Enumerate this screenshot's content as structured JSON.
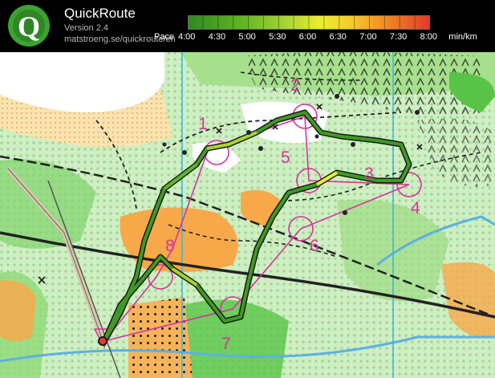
{
  "app": {
    "title": "QuickRoute",
    "version": "Version 2.4",
    "url": "matstroeng.se/quickroute/en",
    "logo_letter": "Q"
  },
  "pace_scale": {
    "label": "Pace",
    "ticks": [
      "4:00",
      "4:30",
      "5:00",
      "5:30",
      "6:00",
      "6:30",
      "7:00",
      "7:30",
      "8:00"
    ],
    "unit": "min/km",
    "colors": [
      "#2f8a1f",
      "#5fb523",
      "#a6d433",
      "#eaee2e",
      "#f7c92c",
      "#f08a26",
      "#e23b2a"
    ]
  },
  "map": {
    "controls": [
      "1",
      "2",
      "3",
      "4",
      "5",
      "6",
      "7",
      "8"
    ],
    "colors": {
      "course": "#d6339f",
      "route_outline": "#1a1a1a",
      "route_fast": "#2f8a1f",
      "route_slow": "#a6d433",
      "vegetation": "#6dcf58",
      "open_land": "#f7a94a",
      "water": "#5db0e3",
      "meridian": "#36b6e0"
    }
  }
}
